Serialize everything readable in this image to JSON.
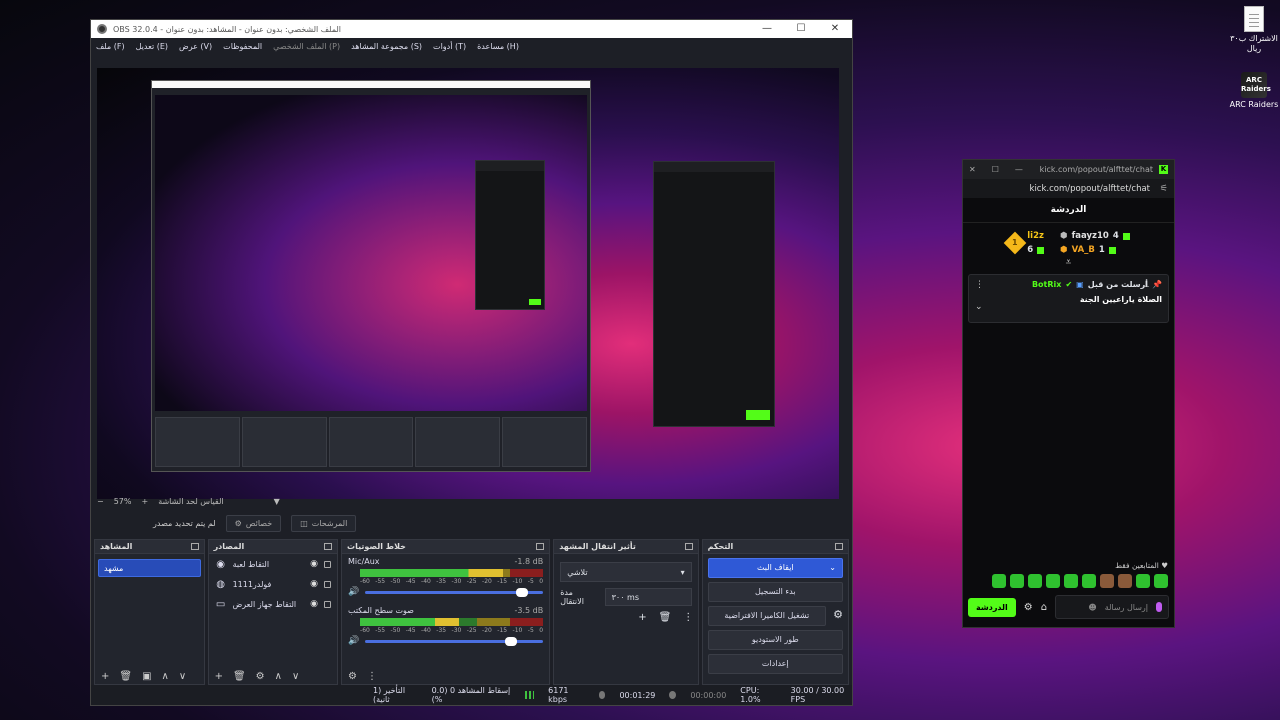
{
  "desktop": {
    "icons": [
      {
        "label": "الاشتراك ب٣٠ ريال",
        "type": "file"
      },
      {
        "label": "ARC Raiders",
        "type": "game"
      }
    ]
  },
  "obs": {
    "title": "OBS 32.0.4 - الملف الشخصي: بدون عنوان - المشاهد: بدون عنوان",
    "window_controls": [
      "—",
      "☐",
      "✕"
    ],
    "menu": [
      {
        "label": "ملف (F)",
        "muted": false
      },
      {
        "label": "تعديل (E)",
        "muted": false
      },
      {
        "label": "عرض (V)",
        "muted": false
      },
      {
        "label": "المحفوظات",
        "muted": false
      },
      {
        "label": "الملف الشخصي (P)",
        "muted": true
      },
      {
        "label": "مجموعة المشاهد (S)",
        "muted": false
      },
      {
        "label": "أدوات (T)",
        "muted": false
      },
      {
        "label": "مساعدة (H)",
        "muted": false
      }
    ],
    "zoom": {
      "minus": "−",
      "value": "57%",
      "plus": "+",
      "fit_label": "القياس لحد الشاشة",
      "arrow": "▼"
    },
    "context": {
      "filters_label": "المرشحات",
      "properties_label": "خصائص",
      "no_source": "لم يتم تحديد مصدر"
    },
    "scenes": {
      "title": "المشاهد",
      "items": [
        "مشهد"
      ],
      "footer": [
        "+",
        "🗑",
        "▣",
        "∧",
        "∨"
      ]
    },
    "sources": {
      "title": "المصادر",
      "items": [
        {
          "name": "التقاط لعبة",
          "icon": "gamepad-icon"
        },
        {
          "name": "فولدر1111",
          "icon": "globe-icon"
        },
        {
          "name": "التقاط جهاز العرض",
          "icon": "monitor-icon"
        }
      ],
      "footer": [
        "+",
        "🗑",
        "⚙",
        "∧",
        "∨"
      ]
    },
    "mixer": {
      "title": "خلاط الصوتيات",
      "ticks": [
        "-60",
        "-55",
        "-50",
        "-45",
        "-40",
        "-35",
        "-30",
        "-25",
        "-20",
        "-15",
        "-10",
        "-5",
        "0"
      ],
      "tracks": [
        {
          "name": "Mic/Aux",
          "db": "-1.8 dB",
          "level": 0.78,
          "volume": 0.88
        },
        {
          "name": "صوت سطح المكتب",
          "db": "-3.5 dB",
          "level": 0.54,
          "volume": 0.82
        }
      ],
      "footer": [
        "⚙",
        "⋮"
      ]
    },
    "transitions": {
      "title": "تأثير انتقال المشهد",
      "selected": "تلاشي",
      "duration_label": "مدة الانتقال",
      "duration_value": "٣٠٠ ms",
      "buttons": [
        "+",
        "🗑",
        "⋮"
      ]
    },
    "controls": {
      "title": "التحكم",
      "stop_stream": "ايقاف البث",
      "start_recording": "بدء التسجيل",
      "virtual_camera": "تشغيل الكاميرا الافتراضية",
      "studio_mode": "طور الاستوديو",
      "settings": "إعدادات"
    },
    "status": {
      "delay": "التأخير (1 ثانية)",
      "dropped": "إسقاط المشاهد 0 (0.0 %)",
      "bitrate": "6171 kbps",
      "stream_time": "00:01:29",
      "rec_time": "00:00:00",
      "cpu": "CPU: 1.0%",
      "fps": "30.00 / 30.00 FPS"
    }
  },
  "kick": {
    "title_url": "kick.com/popout/alfttet/chat",
    "address": "kick.com/popout/alfttet/chat",
    "chat_title": "الدردشة",
    "leaderboard": {
      "first": {
        "name": "li2z",
        "count": "6",
        "rank": "1"
      },
      "second": {
        "name": "faayz10",
        "count": "4"
      },
      "third": {
        "name": "VA_B",
        "count": "1"
      }
    },
    "pinned": {
      "sender": "BotRix",
      "sent_by": "أرسلت من قبل",
      "message": "الصلاة ياراعيين الجنة"
    },
    "subscribers_only": "المتابعين فقط ♥",
    "input_placeholder": "إرسال رسالة",
    "send_label": "الدردشة"
  }
}
